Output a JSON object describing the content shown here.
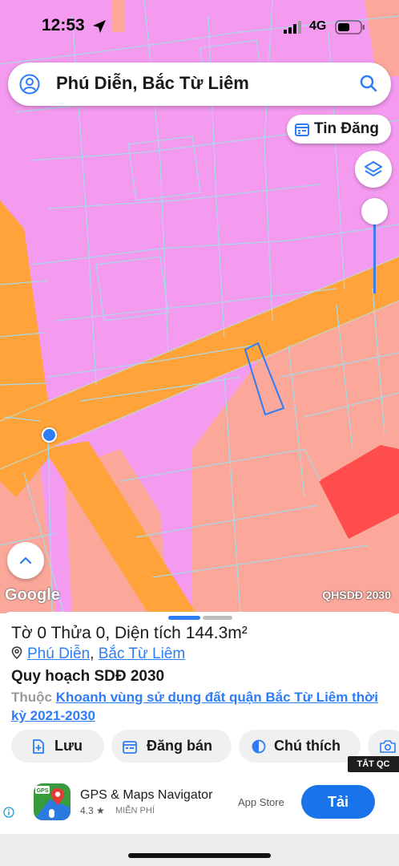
{
  "status_bar": {
    "time": "12:53",
    "network": "4G"
  },
  "search": {
    "query": "Phú Diễn, Bắc Từ Liêm"
  },
  "tin_dang": {
    "label": "Tin Đăng"
  },
  "map": {
    "watermark": "Google",
    "layer_label": "QHSDĐ 2030",
    "colors": {
      "residential": "#f49bf0",
      "road": "#ffa33a",
      "mixed_use": "#fba89a",
      "commercial": "#ff4d4d",
      "parcel_line": "#a8d9e8",
      "selection": "#2e7cf6"
    }
  },
  "sheet": {
    "parcel_info": "Tờ 0 Thửa 0, Diện tích 144.3m²",
    "ward": "Phú Diễn",
    "district": "Bắc Từ Liêm",
    "plan_title": "Quy hoạch SDĐ 2030",
    "belongs_prefix": "Thuộc",
    "belongs_link": "Khoanh vùng sử dụng đất quận Bắc Từ Liêm thời kỳ 2021-2030",
    "actions": {
      "save": "Lưu",
      "post_sale": "Đăng bán",
      "legend": "Chú thích"
    }
  },
  "ad": {
    "close_label": "TẮT QC",
    "app_name": "GPS & Maps Navigator",
    "rating": "4.3 ★",
    "price": "MIỄN PHÍ",
    "store": "App Store",
    "install_label": "Tải"
  }
}
